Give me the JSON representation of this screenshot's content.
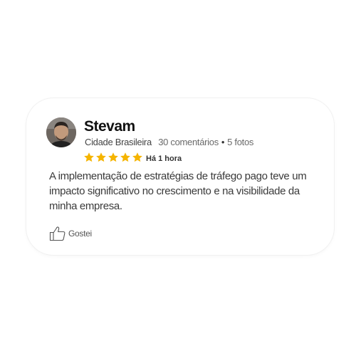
{
  "review_card": {
    "author": {
      "name": "Stevam",
      "location": "Cidade Brasileira",
      "comments": "30 comentários",
      "separator": "•",
      "photos": "5 fotos"
    },
    "rating": {
      "stars": 5,
      "max": 5,
      "star_color": "#f5b400"
    },
    "time": "Há 1 hora",
    "text": "A implementação de estratégias de tráfego pago teve um impacto significativo no crescimento e na visibilidade da minha empresa.",
    "like_label": "Gostei",
    "icons": {
      "star": "star-icon",
      "like": "thumbs-up-icon"
    }
  }
}
